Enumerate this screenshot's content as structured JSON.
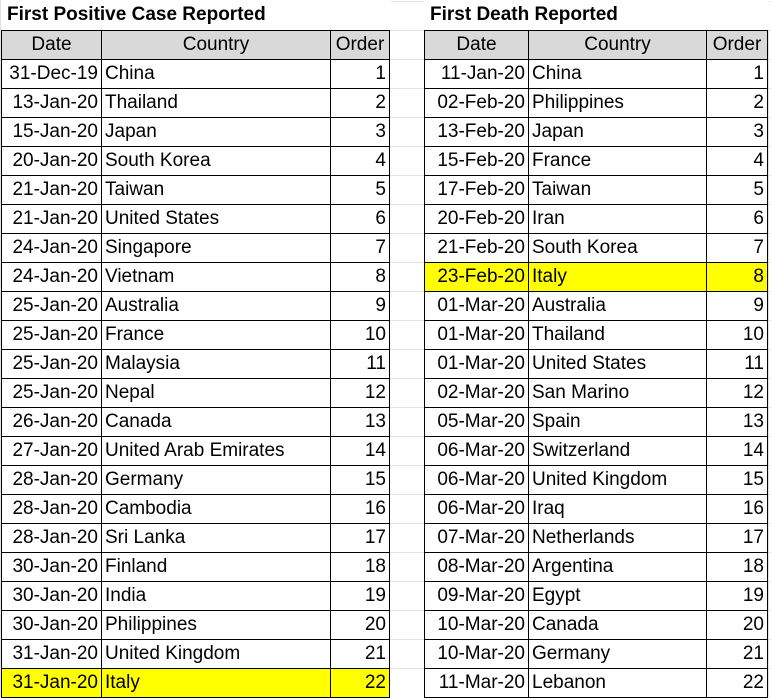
{
  "left": {
    "title": "First Positive Case Reported",
    "headers": {
      "date": "Date",
      "country": "Country",
      "order": "Order"
    },
    "rows": [
      {
        "date": "31-Dec-19",
        "country": "China",
        "order": "1"
      },
      {
        "date": "13-Jan-20",
        "country": "Thailand",
        "order": "2"
      },
      {
        "date": "15-Jan-20",
        "country": "Japan",
        "order": "3"
      },
      {
        "date": "20-Jan-20",
        "country": "South Korea",
        "order": "4"
      },
      {
        "date": "21-Jan-20",
        "country": "Taiwan",
        "order": "5"
      },
      {
        "date": "21-Jan-20",
        "country": "United States",
        "order": "6"
      },
      {
        "date": "24-Jan-20",
        "country": "Singapore",
        "order": "7"
      },
      {
        "date": "24-Jan-20",
        "country": "Vietnam",
        "order": "8"
      },
      {
        "date": "25-Jan-20",
        "country": "Australia",
        "order": "9"
      },
      {
        "date": "25-Jan-20",
        "country": "France",
        "order": "10"
      },
      {
        "date": "25-Jan-20",
        "country": "Malaysia",
        "order": "11"
      },
      {
        "date": "25-Jan-20",
        "country": "Nepal",
        "order": "12"
      },
      {
        "date": "26-Jan-20",
        "country": "Canada",
        "order": "13"
      },
      {
        "date": "27-Jan-20",
        "country": "United Arab Emirates",
        "order": "14"
      },
      {
        "date": "28-Jan-20",
        "country": "Germany",
        "order": "15"
      },
      {
        "date": "28-Jan-20",
        "country": "Cambodia",
        "order": "16"
      },
      {
        "date": "28-Jan-20",
        "country": "Sri Lanka",
        "order": "17"
      },
      {
        "date": "30-Jan-20",
        "country": "Finland",
        "order": "18"
      },
      {
        "date": "30-Jan-20",
        "country": "India",
        "order": "19"
      },
      {
        "date": "30-Jan-20",
        "country": "Philippines",
        "order": "20"
      },
      {
        "date": "31-Jan-20",
        "country": "United Kingdom",
        "order": "21"
      },
      {
        "date": "31-Jan-20",
        "country": "Italy",
        "order": "22",
        "highlight": true
      }
    ]
  },
  "right": {
    "title": "First Death Reported",
    "headers": {
      "date": "Date",
      "country": "Country",
      "order": "Order"
    },
    "rows": [
      {
        "date": "11-Jan-20",
        "country": "China",
        "order": "1"
      },
      {
        "date": "02-Feb-20",
        "country": "Philippines",
        "order": "2"
      },
      {
        "date": "13-Feb-20",
        "country": "Japan",
        "order": "3"
      },
      {
        "date": "15-Feb-20",
        "country": "France",
        "order": "4"
      },
      {
        "date": "17-Feb-20",
        "country": "Taiwan",
        "order": "5"
      },
      {
        "date": "20-Feb-20",
        "country": "Iran",
        "order": "6"
      },
      {
        "date": "21-Feb-20",
        "country": "South Korea",
        "order": "7"
      },
      {
        "date": "23-Feb-20",
        "country": "Italy",
        "order": "8",
        "highlight": true
      },
      {
        "date": "01-Mar-20",
        "country": "Australia",
        "order": "9"
      },
      {
        "date": "01-Mar-20",
        "country": "Thailand",
        "order": "10"
      },
      {
        "date": "01-Mar-20",
        "country": "United States",
        "order": "11"
      },
      {
        "date": "02-Mar-20",
        "country": "San Marino",
        "order": "12"
      },
      {
        "date": "05-Mar-20",
        "country": "Spain",
        "order": "13"
      },
      {
        "date": "06-Mar-20",
        "country": "Switzerland",
        "order": "14"
      },
      {
        "date": "06-Mar-20",
        "country": "United Kingdom",
        "order": "15"
      },
      {
        "date": "06-Mar-20",
        "country": "Iraq",
        "order": "16"
      },
      {
        "date": "07-Mar-20",
        "country": "Netherlands",
        "order": "17"
      },
      {
        "date": "08-Mar-20",
        "country": "Argentina",
        "order": "18"
      },
      {
        "date": "09-Mar-20",
        "country": "Egypt",
        "order": "19"
      },
      {
        "date": "10-Mar-20",
        "country": "Canada",
        "order": "20"
      },
      {
        "date": "10-Mar-20",
        "country": "Germany",
        "order": "21"
      },
      {
        "date": "11-Mar-20",
        "country": "Lebanon",
        "order": "22"
      }
    ]
  },
  "colors": {
    "highlight": "#ffff00",
    "header_bg": "#d9d9d9",
    "grid_line": "#e2e2e2"
  }
}
